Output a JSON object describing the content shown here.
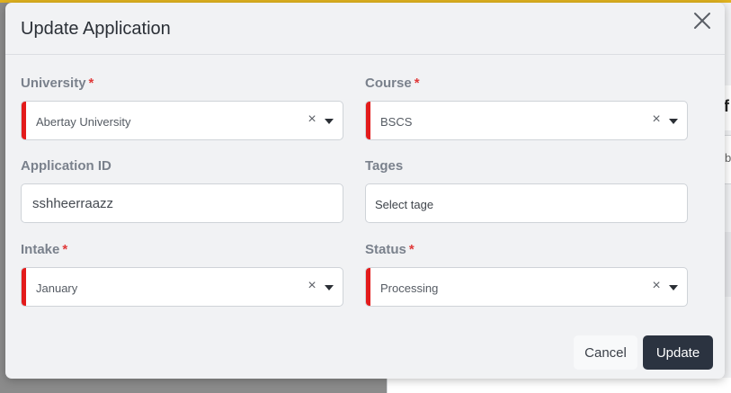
{
  "modal": {
    "title": "Update Application",
    "close_icon": "close-icon"
  },
  "form": {
    "university": {
      "label": "University",
      "required_mark": "*",
      "value": "Abertay University"
    },
    "course": {
      "label": "Course",
      "required_mark": "*",
      "value": "BSCS"
    },
    "application_id": {
      "label": "Application ID",
      "value": "sshheerraazz"
    },
    "tages": {
      "label": "Tages",
      "placeholder": "Select tage"
    },
    "intake": {
      "label": "Intake",
      "required_mark": "*",
      "value": "January"
    },
    "status": {
      "label": "Status",
      "required_mark": "*",
      "value": "Processing"
    }
  },
  "clear_glyph": "×",
  "footer": {
    "cancel_label": "Cancel",
    "update_label": "Update"
  },
  "background": {
    "letter_f": "f",
    "letter_b": "b"
  },
  "colors": {
    "invalid_marker": "#e31b1b",
    "required_asterisk": "#e03a3a",
    "primary_button": "#2b3340",
    "top_accent": "#e0b21f"
  }
}
